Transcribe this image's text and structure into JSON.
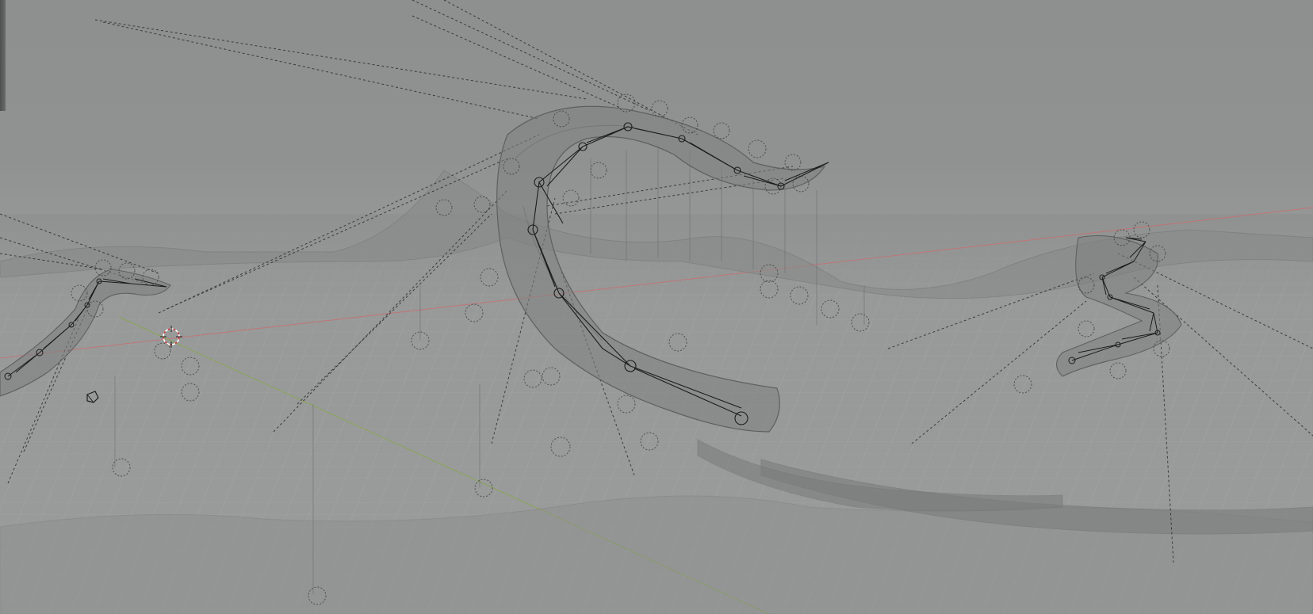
{
  "app": {
    "name": "3D viewport"
  },
  "viewport": {
    "mode": "wireframe-xray",
    "background_color": "#8f9191",
    "grid_color": "#a3a5a5",
    "x_axis_color": "#c26b6b",
    "y_axis_color": "#8da05a",
    "bone_color": "#1e1e1e",
    "mesh_color": "#8a8c8c"
  },
  "scene": {
    "objects": [
      {
        "name": "tentacle-left",
        "kind": "armature-with-mesh"
      },
      {
        "name": "tentacle-center",
        "kind": "armature-with-mesh"
      },
      {
        "name": "tentacle-right",
        "kind": "armature-with-mesh"
      },
      {
        "name": "terrain",
        "kind": "mesh"
      }
    ],
    "cursor_icon": "3d-cursor-icon",
    "light_icon": "light-probe-icon"
  }
}
